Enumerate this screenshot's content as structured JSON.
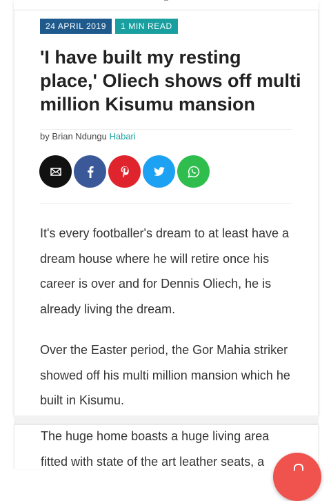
{
  "article": {
    "date": "24 APRIL 2019",
    "read_time": "1 MIN READ",
    "title": "'I have built my resting place,' Oliech shows off multi million Kisumu mansion",
    "byline_prefix": "by Brian Ndungu",
    "category": "Habari",
    "paragraphs": [
      "It's every footballer's dream to at least have a dream house where he will retire once his career is over and for Dennis Oliech, he is already living the dream.",
      "Over the Easter period, the Gor Mahia striker showed off his multi million mansion which he built in Kisumu.",
      "The huge home boasts a huge living area fitted with state of the art leather seats, a"
    ]
  },
  "share": {
    "buttons": [
      {
        "name": "email",
        "icon": "email-icon",
        "color": "#111111"
      },
      {
        "name": "facebook",
        "icon": "facebook-icon",
        "color": "#3b5998"
      },
      {
        "name": "pinterest",
        "icon": "pinterest-icon",
        "color": "#e0242d"
      },
      {
        "name": "twitter",
        "icon": "twitter-icon",
        "color": "#1da1f2"
      },
      {
        "name": "whatsapp",
        "icon": "whatsapp-icon",
        "color": "#2fbe4e"
      }
    ]
  },
  "colors": {
    "date_badge": "#1e5a8c",
    "read_badge": "#1a9fa0",
    "category_link": "#1a9fa0",
    "fab": "#f0524d"
  },
  "fab": {
    "icon": "notification-bell-icon"
  }
}
